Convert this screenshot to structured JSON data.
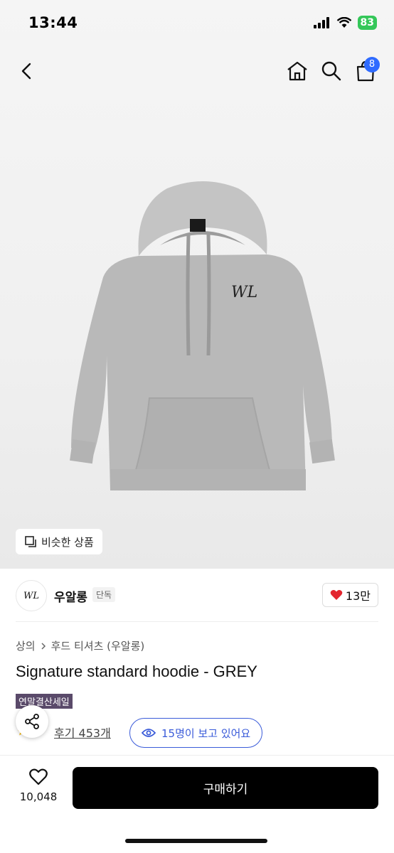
{
  "status_bar": {
    "time": "13:44",
    "battery": "83"
  },
  "nav": {
    "cart_count": "8"
  },
  "hero": {
    "similar_label": "비슷한 상품",
    "logo_mark": "WL"
  },
  "brand": {
    "name": "우알롱",
    "tag": "단독",
    "likes": "13만"
  },
  "product": {
    "breadcrumb": [
      "상의",
      "후드 티셔츠 (우알롱)"
    ],
    "title": "Signature standard hoodie - GREY",
    "sale_badge": "연말결산세일",
    "reviews": "후기 453개",
    "viewers": "15명이 보고 있어요"
  },
  "bottom_bar": {
    "wish_count": "10,048",
    "buy_label": "구매하기"
  },
  "colors": {
    "accent": "#3a5bd9",
    "badge": "#2f6bff",
    "heart": "#e3262f",
    "sale": "#5a4a6a"
  }
}
